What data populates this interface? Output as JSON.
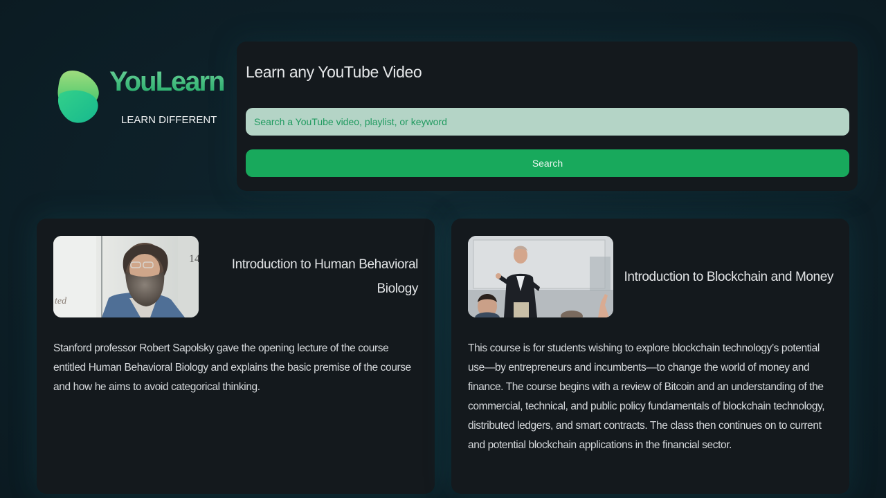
{
  "brand": {
    "name": "YouLearn",
    "tagline": "LEARN DIFFERENT",
    "logo_icon": "heart-leaf-logo-icon",
    "colors": {
      "accent": "#18a95c",
      "logo_light": "#6fd39b",
      "logo_dark": "#1fa966"
    }
  },
  "search": {
    "title": "Learn any YouTube Video",
    "placeholder": "Search a YouTube video, playlist, or keyword",
    "value": "",
    "button_label": "Search"
  },
  "courses": [
    {
      "title": "Introduction to Human Behavioral Biology",
      "description": "Stanford professor Robert Sapolsky gave the opening lecture of the course entitled Human Behavioral Biology and explains the basic premise of the course and how he aims to avoid categorical thinking.",
      "thumbnail": "lecturer-portrait-thumbnail"
    },
    {
      "title": "Introduction to Blockchain and Money",
      "description": "This course is for students wishing to explore blockchain technology’s potential use—by entrepreneurs and incumbents—to change the world of money and finance. The course begins with a review of Bitcoin and an understanding of the commercial, technical, and public policy fundamentals of blockchain technology, distributed ledgers, and smart contracts. The class then continues on to current and potential blockchain applications in the financial sector.",
      "thumbnail": "lecture-hall-thumbnail"
    }
  ]
}
